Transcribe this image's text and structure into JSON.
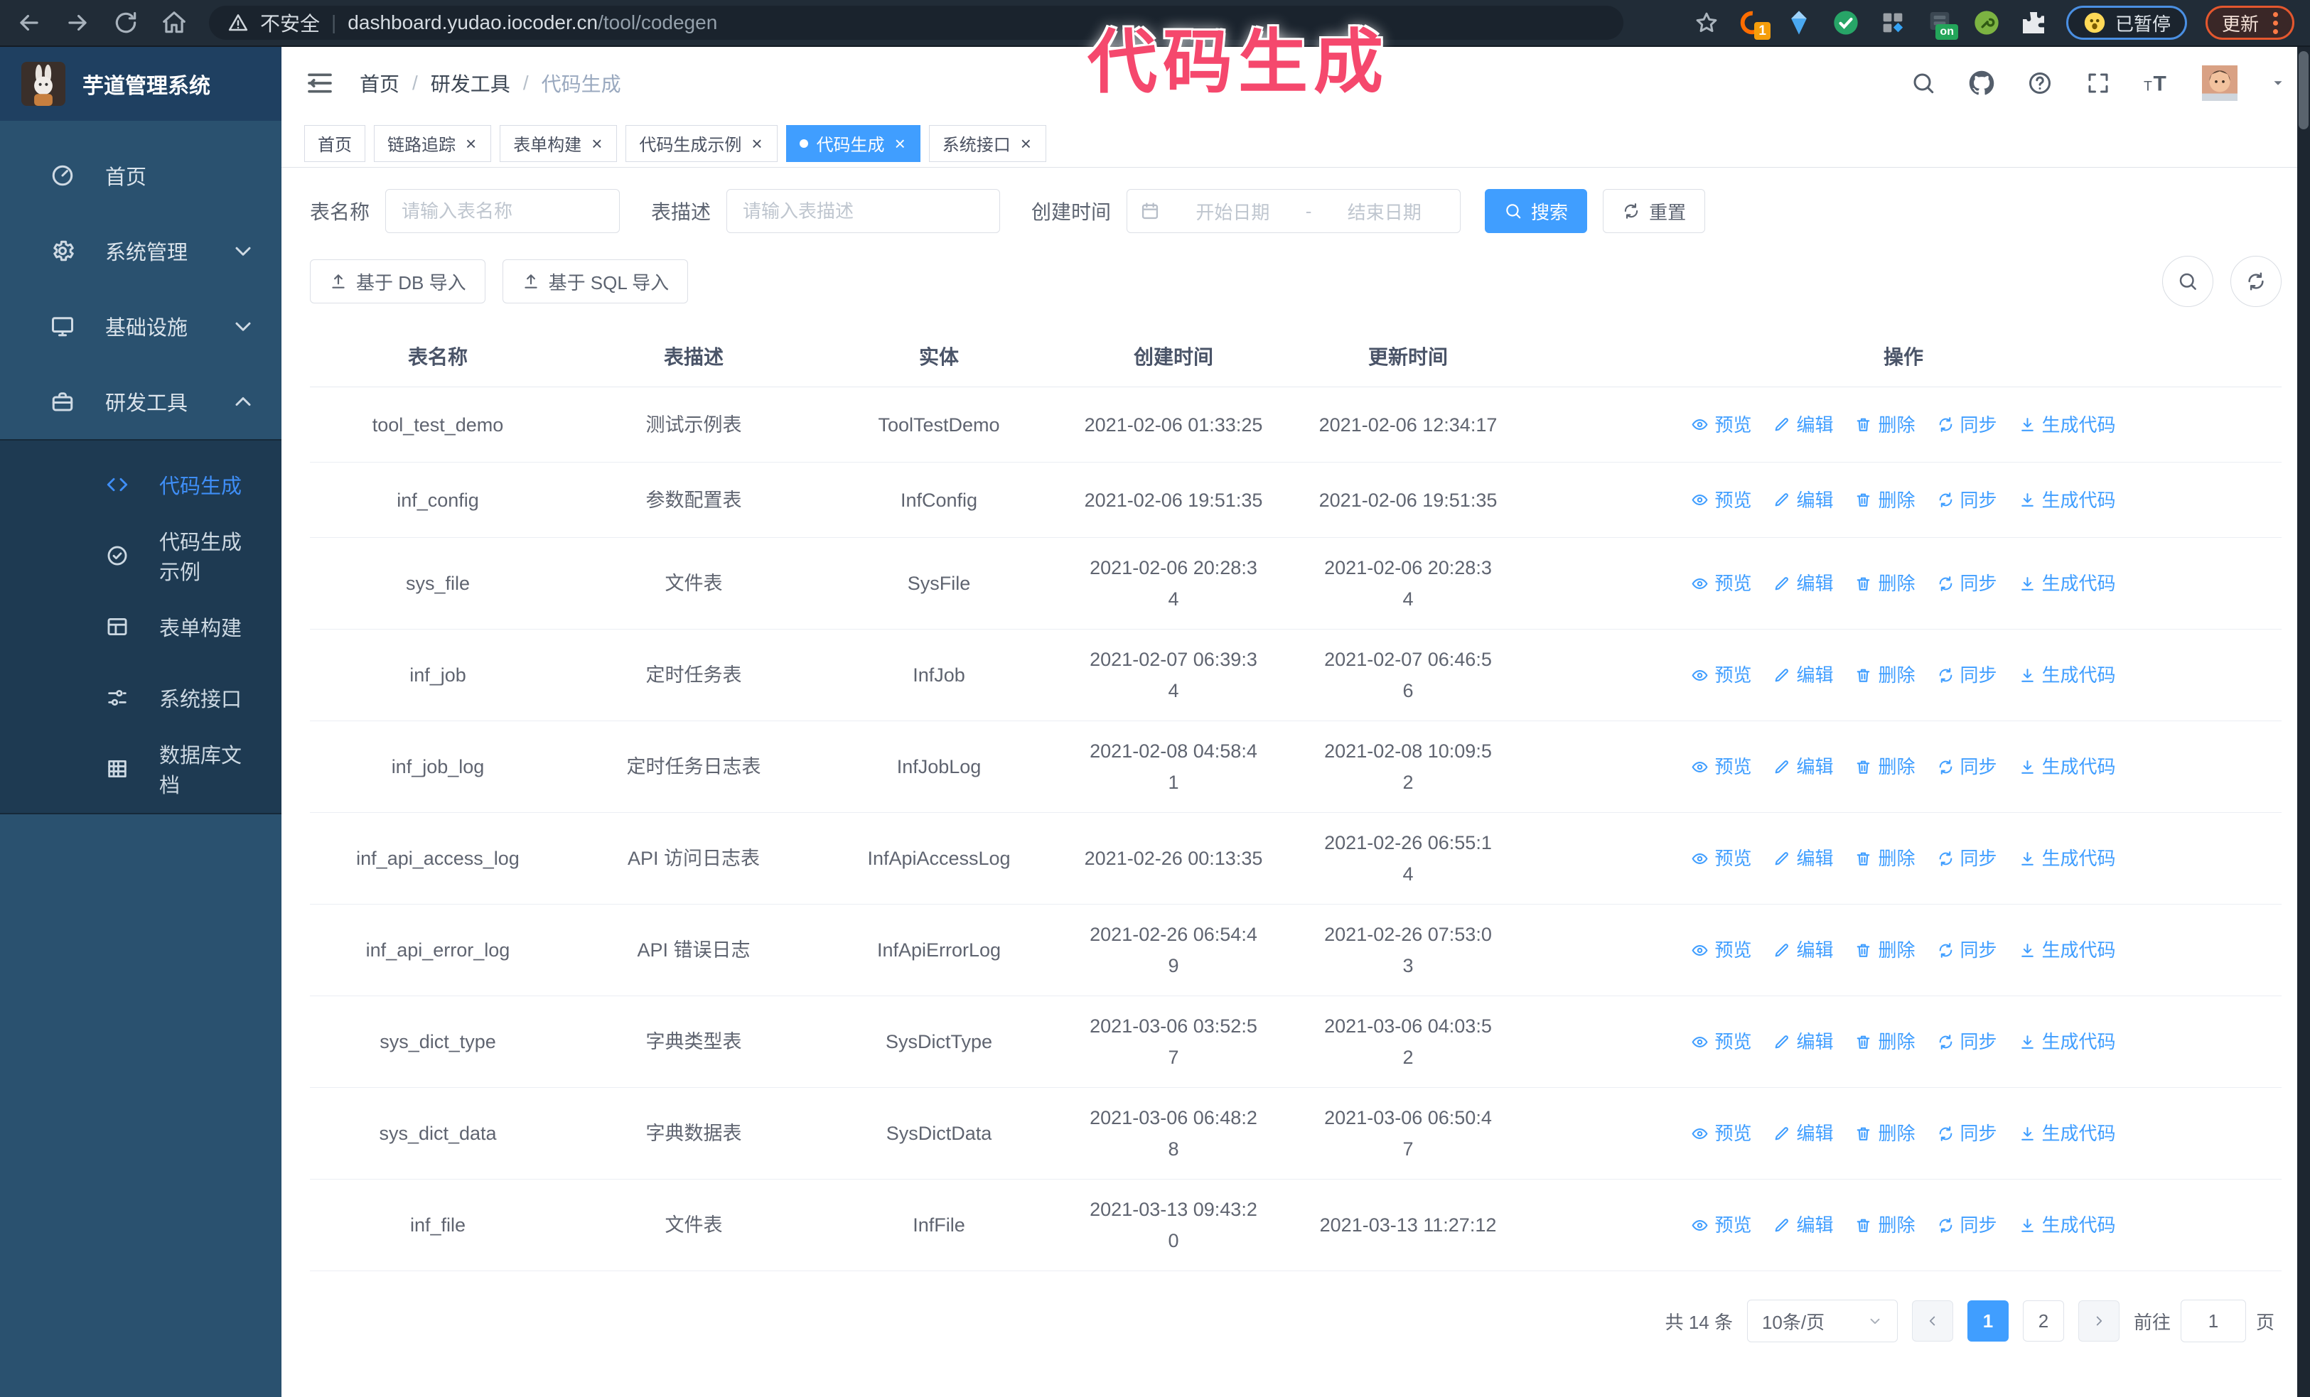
{
  "browser": {
    "security_warning": "不安全",
    "url_host": "dashboard.yudao.iocoder.cn",
    "url_path": "/tool/codegen",
    "ext_badge_count": "1",
    "ext_badge_on": "on",
    "paused_badge": "已暂停",
    "update_badge": "更新"
  },
  "annotation": {
    "text": "代码生成",
    "color": "#f5486d"
  },
  "sidebar": {
    "logo_title": "芋道管理系统",
    "menu": [
      {
        "label": "首页",
        "icon": "dashboard-icon"
      },
      {
        "label": "系统管理",
        "icon": "gear-icon"
      },
      {
        "label": "基础设施",
        "icon": "monitor-icon"
      },
      {
        "label": "研发工具",
        "icon": "toolbox-icon"
      }
    ],
    "submenu": [
      {
        "label": "代码生成",
        "icon": "code-icon",
        "active": true
      },
      {
        "label": "代码生成示例",
        "icon": "badge-check-icon"
      },
      {
        "label": "表单构建",
        "icon": "form-grid-icon"
      },
      {
        "label": "系统接口",
        "icon": "sliders-icon"
      },
      {
        "label": "数据库文档",
        "icon": "db-table-icon"
      }
    ]
  },
  "header": {
    "breadcrumb": {
      "home": "首页",
      "section": "研发工具",
      "current": "代码生成"
    },
    "separator": "/"
  },
  "tabs": [
    {
      "label": "首页",
      "closable": false,
      "active": false
    },
    {
      "label": "链路追踪",
      "closable": true,
      "active": false
    },
    {
      "label": "表单构建",
      "closable": true,
      "active": false
    },
    {
      "label": "代码生成示例",
      "closable": true,
      "active": false
    },
    {
      "label": "代码生成",
      "closable": true,
      "active": true
    },
    {
      "label": "系统接口",
      "closable": true,
      "active": false
    }
  ],
  "glyphs": {
    "close": "×"
  },
  "filters": {
    "table_name_label": "表名称",
    "table_name_placeholder": "请输入表名称",
    "table_desc_label": "表描述",
    "table_desc_placeholder": "请输入表描述",
    "create_time_label": "创建时间",
    "date_start_placeholder": "开始日期",
    "date_separator": "-",
    "date_end_placeholder": "结束日期",
    "search_button": "搜索",
    "reset_button": "重置"
  },
  "toolbar": {
    "import_db_button": "基于 DB 导入",
    "import_sql_button": "基于 SQL 导入"
  },
  "table": {
    "columns": {
      "name": "表名称",
      "desc": "表描述",
      "entity": "实体",
      "create": "创建时间",
      "update": "更新时间",
      "actions": "操作"
    },
    "actions": [
      {
        "key": "preview",
        "label": "预览",
        "icon": "eye"
      },
      {
        "key": "edit",
        "label": "编辑",
        "icon": "pencil"
      },
      {
        "key": "delete",
        "label": "删除",
        "icon": "trash"
      },
      {
        "key": "sync",
        "label": "同步",
        "icon": "sync"
      },
      {
        "key": "generate-code",
        "label": "生成代码",
        "icon": "download"
      }
    ],
    "rows": [
      {
        "name": "tool_test_demo",
        "desc": "测试示例表",
        "entity": "ToolTestDemo",
        "create": "2021-02-06 01:33:25",
        "update": "2021-02-06 12:34:17"
      },
      {
        "name": "inf_config",
        "desc": "参数配置表",
        "entity": "InfConfig",
        "create": "2021-02-06 19:51:35",
        "update": "2021-02-06 19:51:35"
      },
      {
        "name": "sys_file",
        "desc": "文件表",
        "entity": "SysFile",
        "create": "2021-02-06 20:28:3\n4",
        "update": "2021-02-06 20:28:3\n4"
      },
      {
        "name": "inf_job",
        "desc": "定时任务表",
        "entity": "InfJob",
        "create": "2021-02-07 06:39:3\n4",
        "update": "2021-02-07 06:46:5\n6"
      },
      {
        "name": "inf_job_log",
        "desc": "定时任务日志表",
        "entity": "InfJobLog",
        "create": "2021-02-08 04:58:4\n1",
        "update": "2021-02-08 10:09:5\n2"
      },
      {
        "name": "inf_api_access_log",
        "desc": "API 访问日志表",
        "entity": "InfApiAccessLog",
        "create": "2021-02-26 00:13:35",
        "update": "2021-02-26 06:55:1\n4"
      },
      {
        "name": "inf_api_error_log",
        "desc": "API 错误日志",
        "entity": "InfApiErrorLog",
        "create": "2021-02-26 06:54:4\n9",
        "update": "2021-02-26 07:53:0\n3"
      },
      {
        "name": "sys_dict_type",
        "desc": "字典类型表",
        "entity": "SysDictType",
        "create": "2021-03-06 03:52:5\n7",
        "update": "2021-03-06 04:03:5\n2"
      },
      {
        "name": "sys_dict_data",
        "desc": "字典数据表",
        "entity": "SysDictData",
        "create": "2021-03-06 06:48:2\n8",
        "update": "2021-03-06 06:50:4\n7"
      },
      {
        "name": "inf_file",
        "desc": "文件表",
        "entity": "InfFile",
        "create": "2021-03-13 09:43:2\n0",
        "update": "2021-03-13 11:27:12"
      }
    ]
  },
  "pagination": {
    "total_text": "共 14 条",
    "page_size": "10条/页",
    "pages": [
      "1",
      "2"
    ],
    "active_page": "1",
    "goto_label": "前往",
    "goto_value": "1",
    "goto_suffix": "页"
  },
  "colors": {
    "accent": "#409eff",
    "sidebar_bg": "#2a516f",
    "submenu_bg": "#1e3a52",
    "chrome_bg": "#212c37"
  }
}
